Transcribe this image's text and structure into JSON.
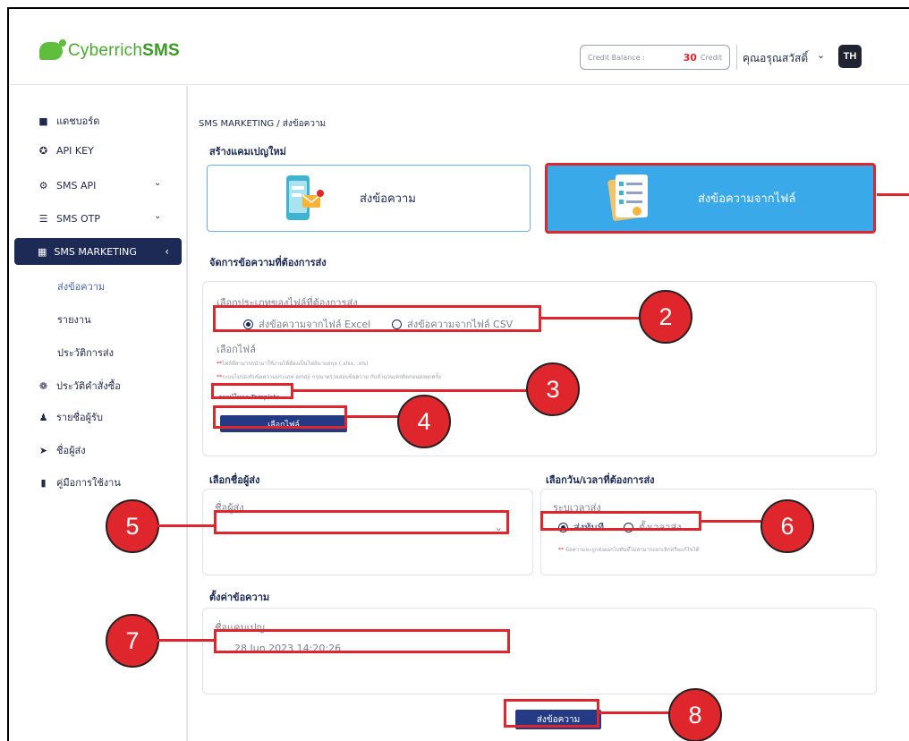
{
  "header": {
    "brand_prefix": "Cyberrich",
    "brand_suffix": "SMS",
    "credit_label": "Credit Balance :",
    "credit_value": "30",
    "credit_unit": "Credit",
    "user_name": "คุณอรุณสวัสดิ์",
    "avatar_initials": "TH"
  },
  "sidebar": {
    "items": [
      {
        "label": "แดชบอร์ด",
        "icon": "dashboard-icon"
      },
      {
        "label": "API KEY",
        "icon": "key-icon"
      },
      {
        "label": "SMS API",
        "icon": "api-icon"
      },
      {
        "label": "SMS OTP",
        "icon": "otp-icon"
      },
      {
        "label": "SMS MARKETING",
        "icon": "marketing-icon"
      },
      {
        "label": "ประวัติคำสั่งซื้อ",
        "icon": "order-history-icon"
      },
      {
        "label": "รายชื่อผู้รับ",
        "icon": "contacts-icon"
      },
      {
        "label": "ชื่อผู้ส่ง",
        "icon": "send-icon"
      },
      {
        "label": "คู่มือการใช้งาน",
        "icon": "manual-icon"
      }
    ],
    "sub_items": [
      {
        "label": "ส่งข้อความ"
      },
      {
        "label": "รายงาน"
      },
      {
        "label": "ประวัติการส่ง"
      }
    ]
  },
  "main": {
    "breadcrumb": "SMS MARKETING / ส่งข้อความ",
    "create_title": "สร้างแคมเปญใหม่",
    "option_send": "ส่งข้อความ",
    "option_file": "ส่งข้อความจากไฟล์",
    "manage_title": "จัดการข้อความที่ต้องการส่ง",
    "file_type_label": "เลือกประเภทของไฟล์ที่ต้องการส่ง",
    "radio_excel": "ส่งข้อความจากไฟล์ Excel",
    "radio_csv": "ส่งข้อความจากไฟล์ CSV",
    "choose_file_label": "เลือกไฟล์",
    "hint_1": "ไฟล์ที่สามารถนำมาใช้งานได้ต้องเป็นไฟล์นามสกุล (.xlsx, .xls)",
    "hint_2": "ระบบไม่รองรับข้อความประเภท emoji กรุณาตรวจสอบข้อความ กับจำนวนเครดิตก่อนส่งทุกครั้ง",
    "hint_star": "**",
    "download_template": "ดาวน์โหลด Template",
    "choose_file_button": "เลือกไฟล์",
    "sender_title": "เลือกชื่อผู้ส่ง",
    "sender_label": "ชื่อผู้ส่ง",
    "schedule_title": "เลือกวัน/เวลาที่ต้องการส่ง",
    "schedule_label": "ระบุเวลาส่ง",
    "radio_now": "ส่งทันที",
    "radio_later": "ตั้งเวลาส่ง",
    "schedule_hint": "ข้อความจะถูกส่งออกไปทันทีไม่สามารถยกเลิกหรือแก้ไขได้",
    "settings_title": "ตั้งค่าข้อความ",
    "campaign_label": "ชื่อแคมเปญ",
    "campaign_value": "28 Jun 2023   14:20:26",
    "submit_button": "ส่งข้อความ"
  },
  "annotations": [
    "2",
    "3",
    "4",
    "5",
    "6",
    "7",
    "8"
  ],
  "colors": {
    "navy": "#1d2a55",
    "button": "#253a85",
    "accent_blue": "#39a9ea",
    "annotation_red": "#e0262d",
    "brand_green": "#4aaa2d"
  }
}
